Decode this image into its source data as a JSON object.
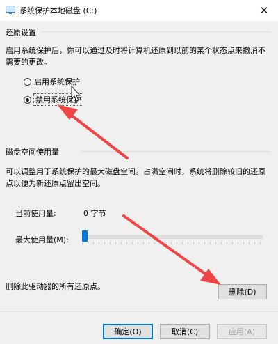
{
  "window": {
    "title": "系统保护本地磁盘 (C:)",
    "close_glyph": "✕"
  },
  "restore": {
    "heading": "还原设置",
    "description": "启用系统保护后，你可以通过及时将计算机还原到以前的某个状态点来撤消不需要的更改。",
    "options": [
      {
        "label": "启用系统保护",
        "checked": false
      },
      {
        "label": "禁用系统保护",
        "checked": true
      }
    ]
  },
  "disk": {
    "heading": "磁盘空间使用量",
    "description": "可以调整用于系统保护的最大磁盘空间。占满空间时，系统将删除较旧的还原点以便为新还原点留出空间。",
    "current_label": "当前使用量:",
    "current_value": "0 字节",
    "max_label": "最大使用量(M):",
    "max_slider_level": 0
  },
  "delete": {
    "description": "删除此驱动器的所有还原点。",
    "button": "删除(D)"
  },
  "footer": {
    "ok": "确定(O)",
    "cancel": "取消(C)",
    "apply": "应用(A)"
  },
  "colors": {
    "accent": "#0078d7",
    "annotation_arrow": "#f04545"
  }
}
